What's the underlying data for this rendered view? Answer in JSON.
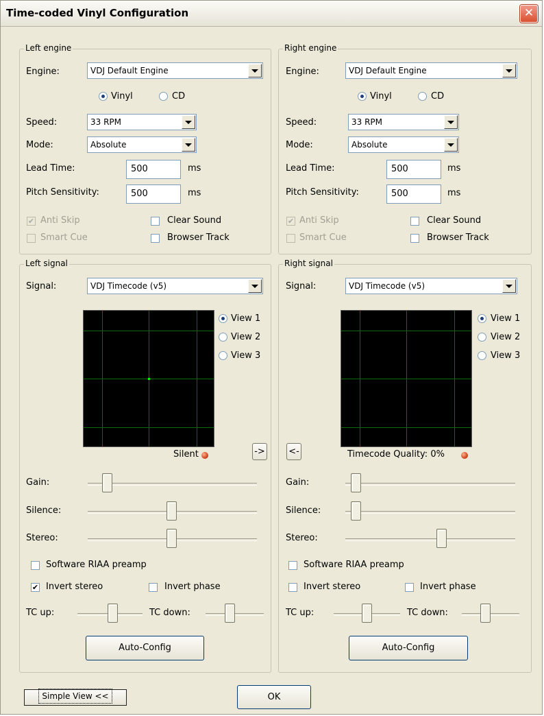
{
  "window": {
    "title": "Time-coded Vinyl Configuration",
    "close_glyph": "✕"
  },
  "left_engine": {
    "group_label": "Left engine",
    "engine_label": "Engine:",
    "engine_value": "VDJ Default Engine",
    "vinyl_label": "Vinyl",
    "cd_label": "CD",
    "selected": "Vinyl",
    "speed_label": "Speed:",
    "speed_value": "33 RPM",
    "mode_label": "Mode:",
    "mode_value": "Absolute",
    "lead_time_label": "Lead Time:",
    "lead_time_value": "500",
    "lead_time_unit": "ms",
    "pitch_label": "Pitch Sensitivity:",
    "pitch_value": "500",
    "pitch_unit": "ms",
    "anti_skip_label": "Anti Skip",
    "anti_skip_checked": true,
    "anti_skip_disabled": true,
    "smart_cue_label": "Smart Cue",
    "smart_cue_checked": false,
    "smart_cue_disabled": true,
    "clear_sound_label": "Clear Sound",
    "clear_sound_checked": false,
    "browser_track_label": "Browser Track",
    "browser_track_checked": false
  },
  "right_engine": {
    "group_label": "Right engine",
    "engine_label": "Engine:",
    "engine_value": "VDJ Default Engine",
    "vinyl_label": "Vinyl",
    "cd_label": "CD",
    "selected": "Vinyl",
    "speed_label": "Speed:",
    "speed_value": "33 RPM",
    "mode_label": "Mode:",
    "mode_value": "Absolute",
    "lead_time_label": "Lead Time:",
    "lead_time_value": "500",
    "lead_time_unit": "ms",
    "pitch_label": "Pitch Sensitivity:",
    "pitch_value": "500",
    "pitch_unit": "ms",
    "anti_skip_label": "Anti Skip",
    "anti_skip_checked": true,
    "anti_skip_disabled": true,
    "smart_cue_label": "Smart Cue",
    "smart_cue_checked": false,
    "smart_cue_disabled": true,
    "clear_sound_label": "Clear Sound",
    "clear_sound_checked": false,
    "browser_track_label": "Browser Track",
    "browser_track_checked": false
  },
  "left_signal": {
    "group_label": "Left signal",
    "signal_label": "Signal:",
    "signal_value": "VDJ Timecode (v5)",
    "views": [
      "View 1",
      "View 2",
      "View 3"
    ],
    "selected_view": "View 1",
    "status_text": "Silent",
    "arrow_button": "->",
    "gain_label": "Gain:",
    "gain_level": 0.13,
    "silence_label": "Silence:",
    "silence_level": 0.5,
    "stereo_label": "Stereo:",
    "stereo_level": 0.5,
    "riaa_label": "Software RIAA preamp",
    "riaa_checked": false,
    "invert_stereo_label": "Invert stereo",
    "invert_stereo_checked": true,
    "invert_phase_label": "Invert phase",
    "invert_phase_checked": false,
    "tc_up_label": "TC up:",
    "tc_up_level": 0.5,
    "tc_down_label": "TC down:",
    "tc_down_level": 0.5,
    "auto_config_label": "Auto-Config"
  },
  "right_signal": {
    "group_label": "Right signal",
    "signal_label": "Signal:",
    "signal_value": "VDJ Timecode (v5)",
    "views": [
      "View 1",
      "View 2",
      "View 3"
    ],
    "selected_view": "View 1",
    "status_text": "Timecode Quality:  0%",
    "arrow_button": "<-",
    "gain_label": "Gain:",
    "gain_level": 0.05,
    "silence_label": "Silence:",
    "silence_level": 0.05,
    "stereo_label": "Stereo:",
    "stereo_level": 0.57,
    "riaa_label": "Software RIAA preamp",
    "riaa_checked": false,
    "invert_stereo_label": "Invert stereo",
    "invert_stereo_checked": false,
    "invert_phase_label": "Invert phase",
    "invert_phase_checked": false,
    "tc_up_label": "TC up:",
    "tc_up_level": 0.5,
    "tc_down_label": "TC down:",
    "tc_down_level": 0.5,
    "auto_config_label": "Auto-Config"
  },
  "footer": {
    "simple_view_label": "Simple View <<",
    "ok_label": "OK"
  },
  "colors": {
    "dialog_bg": "#ECE9D8",
    "scope_bg": "#000000",
    "scope_grid": "#0b6b0b",
    "scope_dot": "#00ff00",
    "led": "#c93b14",
    "close_button": "#d9502f"
  }
}
